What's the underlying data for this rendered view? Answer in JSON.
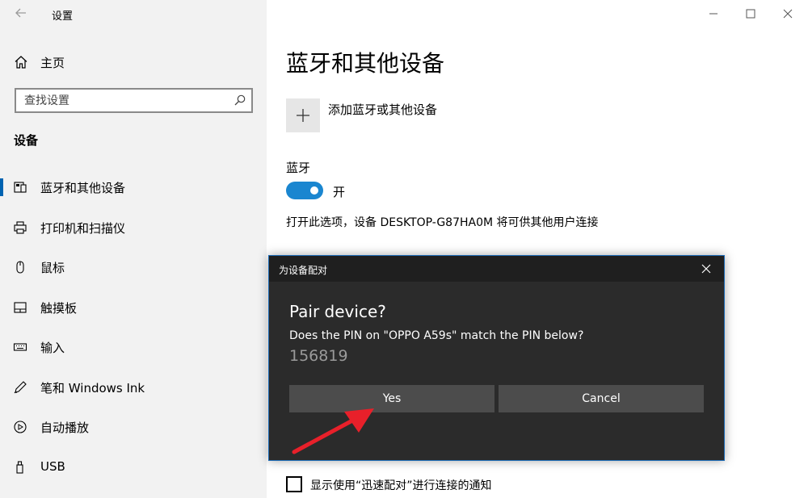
{
  "app": {
    "title": "设置"
  },
  "sidebar": {
    "home_label": "主页",
    "search_placeholder": "查找设置",
    "section_title": "设备",
    "items": [
      {
        "label": "蓝牙和其他设备",
        "icon": "bluetooth-devices-icon",
        "active": true
      },
      {
        "label": "打印机和扫描仪",
        "icon": "printer-icon",
        "active": false
      },
      {
        "label": "鼠标",
        "icon": "mouse-icon",
        "active": false
      },
      {
        "label": "触摸板",
        "icon": "touchpad-icon",
        "active": false
      },
      {
        "label": "输入",
        "icon": "keyboard-icon",
        "active": false
      },
      {
        "label": "笔和 Windows Ink",
        "icon": "pen-icon",
        "active": false
      },
      {
        "label": "自动播放",
        "icon": "autoplay-icon",
        "active": false
      },
      {
        "label": "USB",
        "icon": "usb-icon",
        "active": false
      }
    ]
  },
  "main": {
    "page_title": "蓝牙和其他设备",
    "add_device_label": "添加蓝牙或其他设备",
    "bluetooth_label": "蓝牙",
    "bluetooth_state": "开",
    "bluetooth_on": true,
    "discoverable_text": "打开此选项，设备 DESKTOP-G87HA0M 将可供其他用户连接",
    "swift_pair_label": "显示使用“迅速配对”进行连接的通知",
    "swift_pair_checked": false
  },
  "dialog": {
    "title": "为设备配对",
    "heading": "Pair device?",
    "question": "Does the PIN on \"OPPO A59s\" match the PIN below?",
    "pin": "156819",
    "yes_label": "Yes",
    "cancel_label": "Cancel"
  },
  "colors": {
    "accent": "#0063b1",
    "toggle_on": "#1a86d0",
    "dialog_bg": "#2b2b2b",
    "dialog_button": "#4c4c4c",
    "annotation_arrow": "#e8202a"
  }
}
